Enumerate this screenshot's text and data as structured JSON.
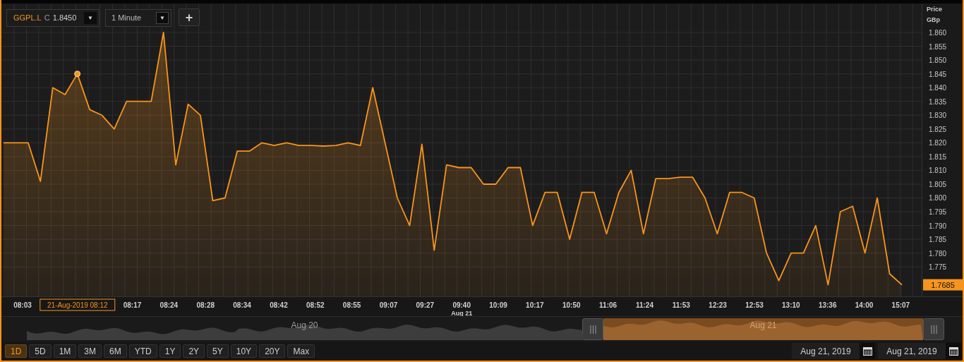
{
  "toolbar": {
    "price_prefix": "C",
    "price": "1.8450",
    "symbol_dropdown_glyph": "▼",
    "interval": "1 Minute",
    "interval_dropdown_glyph": "▼",
    "add_glyph": "+"
  },
  "chart": {
    "last_price": "1.7685",
    "day_label": "Aug 21",
    "time_labels": [
      {
        "text": "08:03",
        "kind": "tick"
      },
      {
        "text": "21-Aug-2019 08:12",
        "kind": "crosshair"
      },
      {
        "text": "08:17",
        "kind": "tick"
      },
      {
        "text": "08:24",
        "kind": "tick"
      },
      {
        "text": "08:28",
        "kind": "tick"
      },
      {
        "text": "08:34",
        "kind": "tick"
      },
      {
        "text": "08:42",
        "kind": "tick"
      },
      {
        "text": "08:52",
        "kind": "tick"
      },
      {
        "text": "08:55",
        "kind": "tick"
      },
      {
        "text": "09:07",
        "kind": "tick"
      },
      {
        "text": "09:27",
        "kind": "tick"
      },
      {
        "text": "09:40",
        "kind": "tick"
      },
      {
        "text": "10:09",
        "kind": "tick"
      },
      {
        "text": "10:17",
        "kind": "tick"
      },
      {
        "text": "10:50",
        "kind": "tick"
      },
      {
        "text": "11:06",
        "kind": "tick"
      },
      {
        "text": "11:24",
        "kind": "tick"
      },
      {
        "text": "11:53",
        "kind": "tick"
      },
      {
        "text": "12:23",
        "kind": "tick"
      },
      {
        "text": "12:53",
        "kind": "tick"
      },
      {
        "text": "13:10",
        "kind": "tick"
      },
      {
        "text": "13:36",
        "kind": "tick"
      },
      {
        "text": "14:00",
        "kind": "tick"
      },
      {
        "text": "15:07",
        "kind": "tick"
      }
    ],
    "chart_data": {
      "type": "area",
      "ylabel": "Price GBp",
      "grid": true,
      "series": [
        {
          "name": "GGPL.L",
          "color": "#f7941d",
          "values": [
            1.82,
            1.82,
            1.82,
            1.806,
            1.84,
            1.8375,
            1.845,
            1.832,
            1.83,
            1.825,
            1.835,
            1.835,
            1.835,
            1.86,
            1.812,
            1.834,
            1.83,
            1.799,
            1.8,
            1.817,
            1.817,
            1.82,
            1.819,
            1.82,
            1.819,
            1.819,
            1.8188,
            1.819,
            1.82,
            1.819,
            1.84,
            1.82,
            1.8,
            1.79,
            1.8195,
            1.781,
            1.812,
            1.811,
            1.811,
            1.805,
            1.805,
            1.811,
            1.811,
            1.79,
            1.802,
            1.802,
            1.785,
            1.802,
            1.802,
            1.787,
            1.802,
            1.81,
            1.787,
            1.807,
            1.807,
            1.8075,
            1.8075,
            1.8,
            1.787,
            1.802,
            1.802,
            1.8,
            1.78,
            1.77,
            1.78,
            1.78,
            1.79,
            1.7685,
            1.795,
            1.797,
            1.78,
            1.8,
            1.7725,
            1.7685
          ]
        }
      ],
      "ylim": [
        1.7643,
        1.8705
      ],
      "yticks": [
        {
          "value": 1.775,
          "label": "1.775"
        },
        {
          "value": 1.78,
          "label": "1.780"
        },
        {
          "value": 1.785,
          "label": "1.785"
        },
        {
          "value": 1.79,
          "label": "1.790"
        },
        {
          "value": 1.795,
          "label": "1.795"
        },
        {
          "value": 1.8,
          "label": "1.800"
        },
        {
          "value": 1.805,
          "label": "1.805"
        },
        {
          "value": 1.81,
          "label": "1.810"
        },
        {
          "value": 1.815,
          "label": "1.815"
        },
        {
          "value": 1.82,
          "label": "1.820"
        },
        {
          "value": 1.825,
          "label": "1.825"
        },
        {
          "value": 1.83,
          "label": "1.830"
        },
        {
          "value": 1.835,
          "label": "1.835"
        },
        {
          "value": 1.84,
          "label": "1.840"
        },
        {
          "value": 1.845,
          "label": "1.845"
        },
        {
          "value": 1.85,
          "label": "1.850"
        },
        {
          "value": 1.855,
          "label": "1.855"
        },
        {
          "value": 1.86,
          "label": "1.860"
        }
      ]
    }
  },
  "navigator": {
    "segments": [
      {
        "label": "Aug 20",
        "selected": false
      },
      {
        "label": "Aug 21",
        "selected": true
      }
    ]
  },
  "ranges": [
    {
      "label": "1D",
      "selected": true
    },
    {
      "label": "5D",
      "selected": false
    },
    {
      "label": "1M",
      "selected": false
    },
    {
      "label": "3M",
      "selected": false
    },
    {
      "label": "6M",
      "selected": false
    },
    {
      "label": "YTD",
      "selected": false
    },
    {
      "label": "1Y",
      "selected": false
    },
    {
      "label": "2Y",
      "selected": false
    },
    {
      "label": "5Y",
      "selected": false
    },
    {
      "label": "10Y",
      "selected": false
    },
    {
      "label": "20Y",
      "selected": false
    },
    {
      "label": "Max",
      "selected": false
    }
  ],
  "date_range": {
    "from": "Aug 21, 2019",
    "to": "Aug 21, 2019"
  }
}
